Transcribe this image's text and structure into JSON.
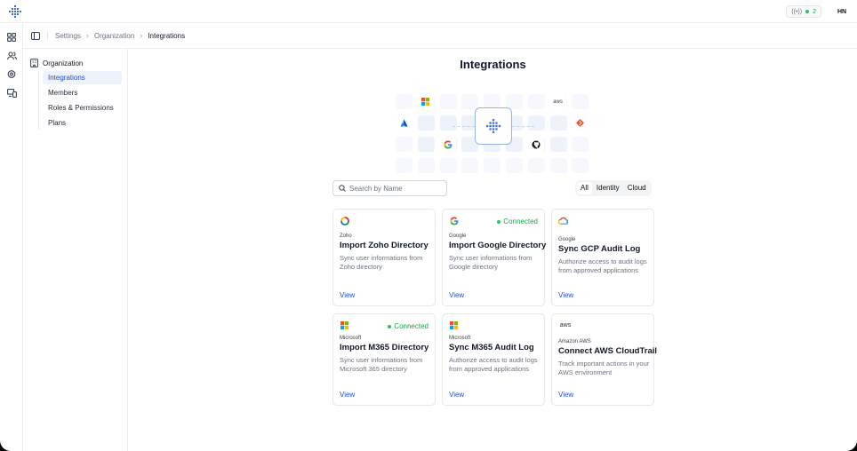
{
  "header": {
    "status_count": "2",
    "user_initials": "HN"
  },
  "breadcrumb": [
    "Settings",
    "Organization",
    "Integrations"
  ],
  "sidebar": {
    "heading": "Organization",
    "items": [
      {
        "label": "Integrations",
        "active": true
      },
      {
        "label": "Members",
        "active": false
      },
      {
        "label": "Roles & Permissions",
        "active": false
      },
      {
        "label": "Plans",
        "active": false
      }
    ]
  },
  "main": {
    "title": "Integrations",
    "hero_logos": [
      "microsoft-icon",
      "aws-icon",
      "atlassian-icon",
      "git-icon",
      "google-icon",
      "github-icon"
    ],
    "hero_aws_text": "aws",
    "search_placeholder": "Search by Name",
    "filters": [
      {
        "label": "All",
        "active": true
      },
      {
        "label": "Identity",
        "active": false
      },
      {
        "label": "Cloud",
        "active": false
      }
    ],
    "cards": [
      {
        "icon": "zoho-icon",
        "vendor": "Zoho",
        "title": "Import Zoho Directory",
        "desc": "Sync user informations from Zoho directory",
        "badge": "",
        "view": "View"
      },
      {
        "icon": "google-icon",
        "vendor": "Google",
        "title": "Import Google Directory",
        "desc": "Sync user informations from Google directory",
        "badge": "Connected",
        "view": "View"
      },
      {
        "icon": "gcp-icon",
        "vendor": "Google",
        "title": "Sync GCP Audit Log",
        "desc": "Authorize access to audit logs from approved applications",
        "badge": "",
        "view": "View"
      },
      {
        "icon": "microsoft-icon",
        "vendor": "Microsoft",
        "title": "Import M365 Directory",
        "desc": "Sync user informations from Microsoft 365 directory",
        "badge": "Connected",
        "view": "View"
      },
      {
        "icon": "microsoft-icon",
        "vendor": "Microsoft",
        "title": "Sync M365 Audit Log",
        "desc": "Authorize access to audit logs from approved applications",
        "badge": "",
        "view": "View"
      },
      {
        "icon": "aws-icon",
        "vendor": "Amazon AWS",
        "title": "Connect AWS CloudTrail",
        "desc": "Track important actions in your AWS environment",
        "badge": "",
        "view": "View",
        "logo_text": "aws"
      }
    ]
  },
  "colors": {
    "accent": "#1d4ed8",
    "connected": "#16a34a",
    "active_nav_bg": "#eef2fb"
  }
}
